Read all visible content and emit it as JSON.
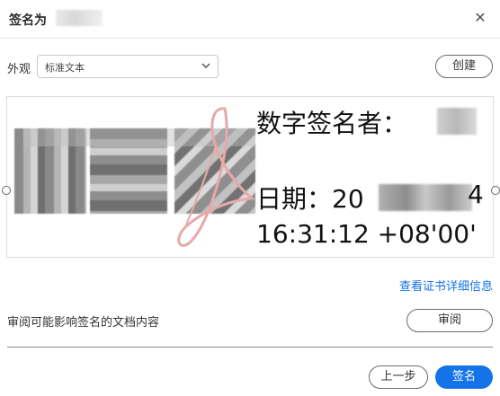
{
  "dialog": {
    "title": "签名为"
  },
  "appearance": {
    "label": "外观",
    "selected": "标准文本",
    "create_label": "创建"
  },
  "preview": {
    "signer_label": "数字签名者：",
    "date_prefix": "日期：20",
    "date_suffix": "4",
    "time": "16:31:12 +08'00'"
  },
  "links": {
    "cert_details": "查看证书详细信息"
  },
  "review": {
    "text": "审阅可能影响签名的文档内容",
    "button_label": "审阅"
  },
  "footer": {
    "back_label": "上一步",
    "sign_label": "签名"
  },
  "colors": {
    "accent": "#1473e6",
    "logo": "#e8a8a8"
  },
  "icons": {
    "close": "close-icon",
    "dropdown": "chevron-down-icon",
    "logo": "pdf-logo-watermark"
  }
}
